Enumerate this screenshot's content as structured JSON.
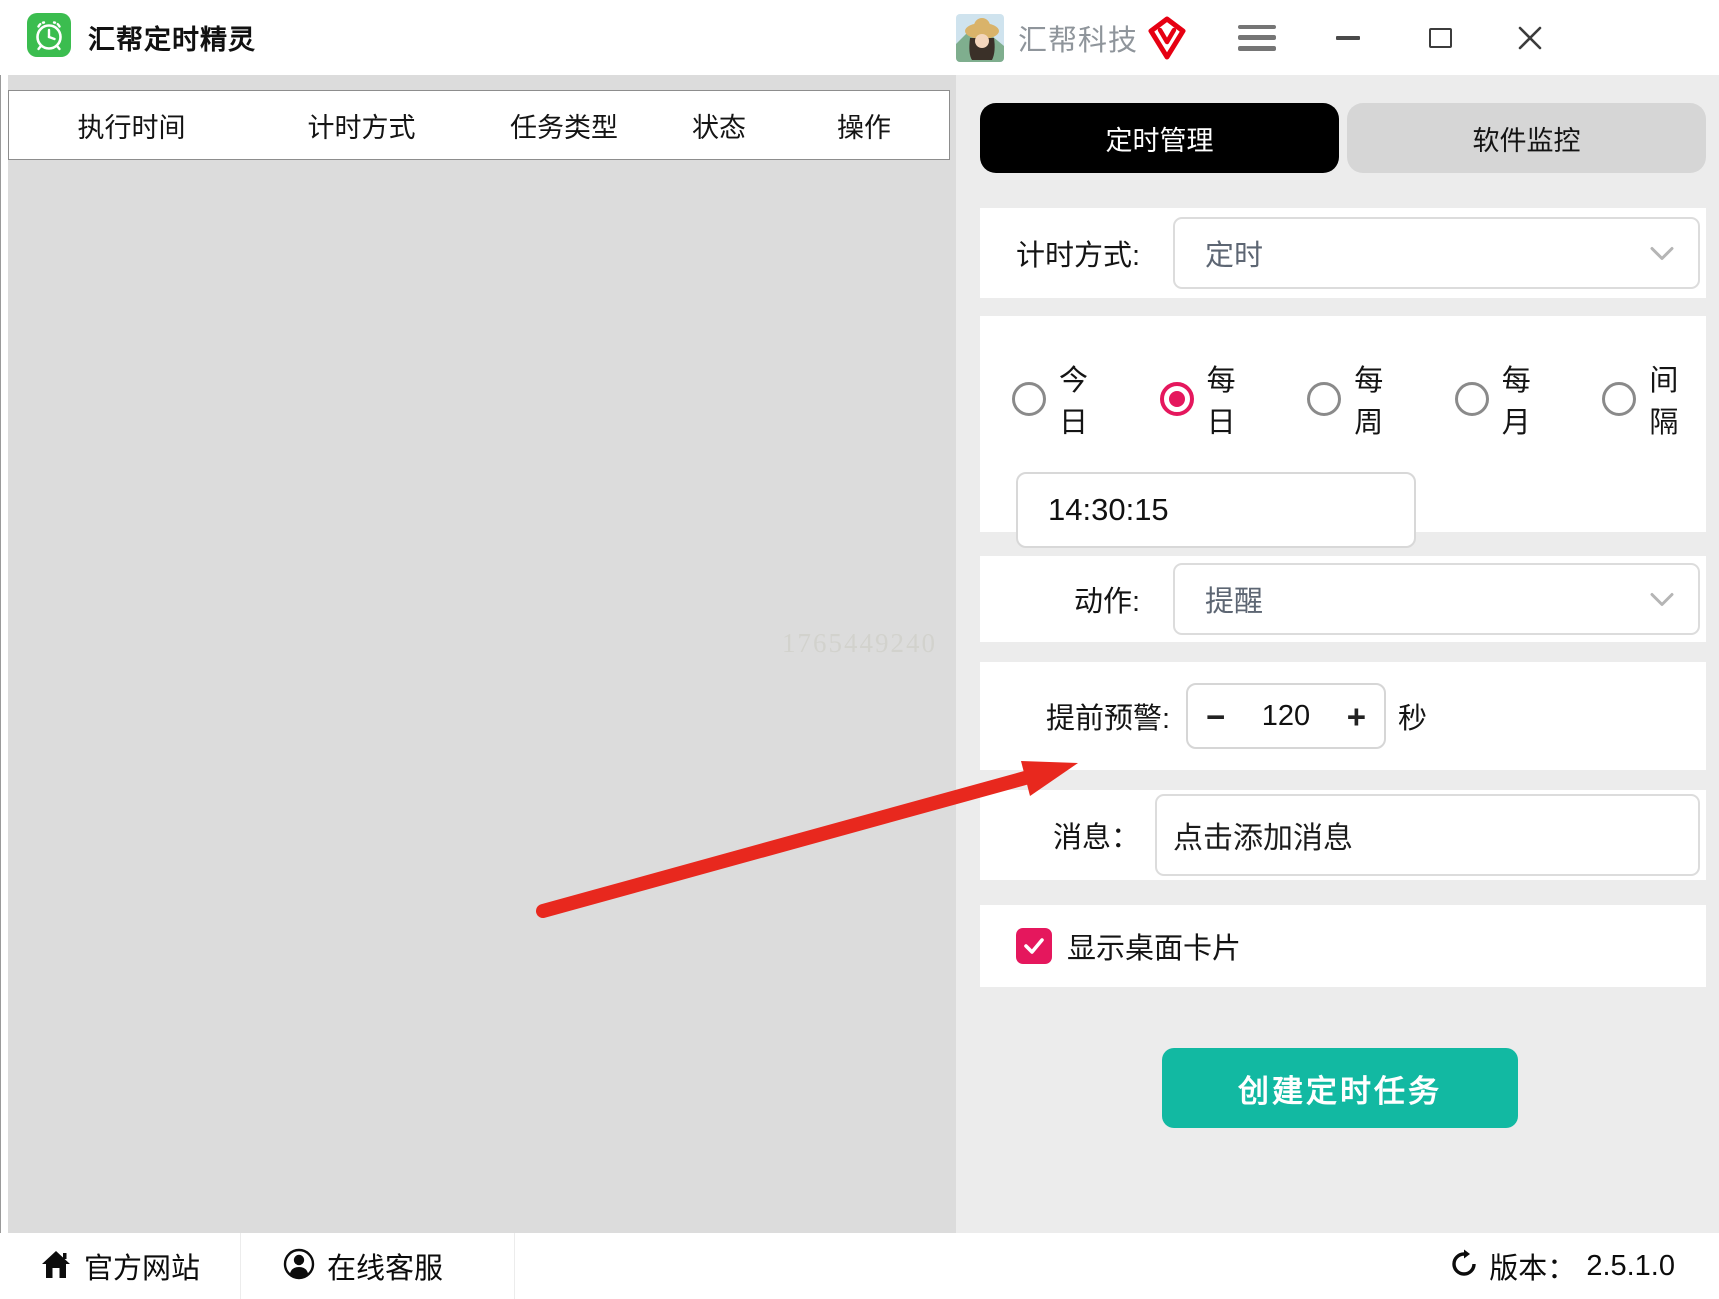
{
  "titlebar": {
    "title": "汇帮定时精灵",
    "brand": "汇帮科技"
  },
  "table": {
    "headers": [
      "执行时间",
      "计时方式",
      "任务类型",
      "状态",
      "操作"
    ]
  },
  "tabs": [
    {
      "label": "定时管理",
      "active": true
    },
    {
      "label": "软件监控",
      "active": false
    }
  ],
  "form": {
    "timing_label": "计时方式:",
    "timing_value": "定时",
    "frequency_options": [
      {
        "label": "今日",
        "selected": false
      },
      {
        "label": "每日",
        "selected": true
      },
      {
        "label": "每周",
        "selected": false
      },
      {
        "label": "每月",
        "selected": false
      },
      {
        "label": "间隔",
        "selected": false
      }
    ],
    "time_value": "14:30:15",
    "action_label": "动作:",
    "action_value": "提醒",
    "warning_label": "提前预警:",
    "warning_minus": "−",
    "warning_value": "120",
    "warning_plus": "+",
    "warning_unit": "秒",
    "message_label": "消息：",
    "message_value": "点击添加消息",
    "show_card_label": "显示桌面卡片",
    "show_card_checked": true,
    "submit_label": "创建定时任务"
  },
  "footer": {
    "website": "官方网站",
    "support": "在线客服",
    "version_label": "版本：",
    "version": "2.5.1.0"
  },
  "watermark": "1765449240",
  "colors": {
    "accent_pink": "#e5175d",
    "accent_teal": "#12b9a2",
    "arrow_red": "#e8281e",
    "app_icon_green": "#3bbd4f",
    "badge_red": "#e60012",
    "tab_active_bg": "#000000",
    "left_panel_bg": "#dcdcdc",
    "right_panel_bg": "#ececec"
  }
}
